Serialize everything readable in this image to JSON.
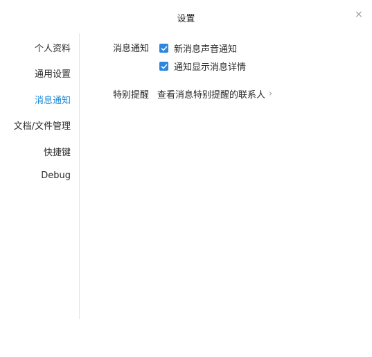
{
  "window": {
    "title": "设置",
    "close_glyph": "×"
  },
  "sidebar": {
    "items": [
      {
        "label": "个人资料",
        "active": false
      },
      {
        "label": "通用设置",
        "active": false
      },
      {
        "label": "消息通知",
        "active": true
      },
      {
        "label": "文档/文件管理",
        "active": false
      },
      {
        "label": "快捷键",
        "active": false
      },
      {
        "label": "Debug",
        "active": false
      }
    ]
  },
  "notifications": {
    "section_label": "消息通知",
    "options": [
      {
        "label": "新消息声音通知",
        "checked": true
      },
      {
        "label": "通知显示消息详情",
        "checked": true
      }
    ]
  },
  "special_reminder": {
    "label": "特别提醒",
    "link_text": "查看消息特别提醒的联系人",
    "chevron": "›"
  },
  "colors": {
    "accent": "#2e86de",
    "active_nav": "#1e88d6"
  }
}
